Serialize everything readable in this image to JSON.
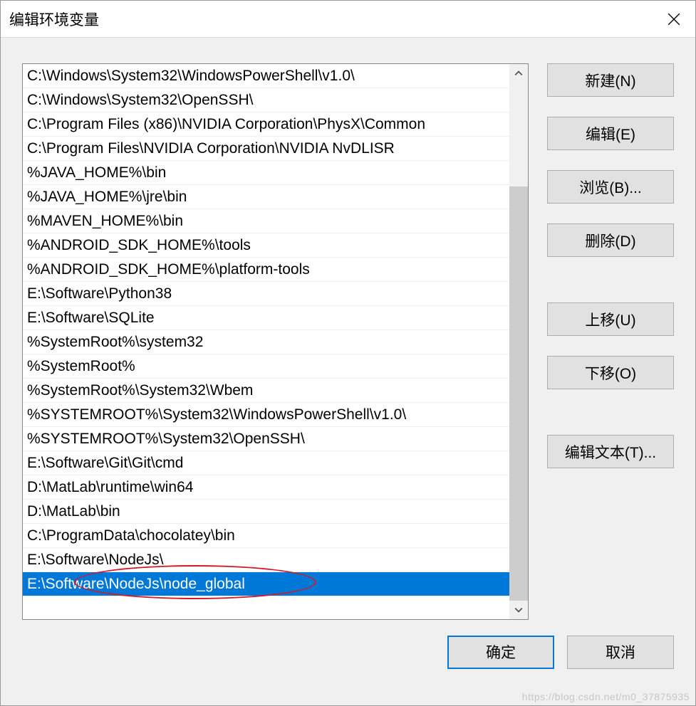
{
  "title": "编辑环境变量",
  "list": {
    "selectedIndex": 22,
    "items": [
      "C:\\Windows\\System32\\WindowsPowerShell\\v1.0\\",
      "C:\\Windows\\System32\\OpenSSH\\",
      "C:\\Program Files (x86)\\NVIDIA Corporation\\PhysX\\Common",
      "C:\\Program Files\\NVIDIA Corporation\\NVIDIA NvDLISR",
      "%JAVA_HOME%\\bin",
      "%JAVA_HOME%\\jre\\bin",
      "%MAVEN_HOME%\\bin",
      "%ANDROID_SDK_HOME%\\tools",
      "%ANDROID_SDK_HOME%\\platform-tools",
      "E:\\Software\\Python38",
      "E:\\Software\\SQLite",
      "%SystemRoot%\\system32",
      "%SystemRoot%",
      "%SystemRoot%\\System32\\Wbem",
      "%SYSTEMROOT%\\System32\\WindowsPowerShell\\v1.0\\",
      "%SYSTEMROOT%\\System32\\OpenSSH\\",
      "E:\\Software\\Git\\Git\\cmd",
      "D:\\MatLab\\runtime\\win64",
      "D:\\MatLab\\bin",
      "C:\\ProgramData\\chocolatey\\bin",
      "E:\\Software\\NodeJs\\",
      "E:\\Software\\NodeJs\\node_global"
    ]
  },
  "buttons": {
    "new_": "新建(N)",
    "edit": "编辑(E)",
    "browse": "浏览(B)...",
    "delete_": "删除(D)",
    "moveUp": "上移(U)",
    "moveDown": "下移(O)",
    "editText": "编辑文本(T)...",
    "ok": "确定",
    "cancel": "取消"
  },
  "watermark": "https://blog.csdn.net/m0_37875935"
}
